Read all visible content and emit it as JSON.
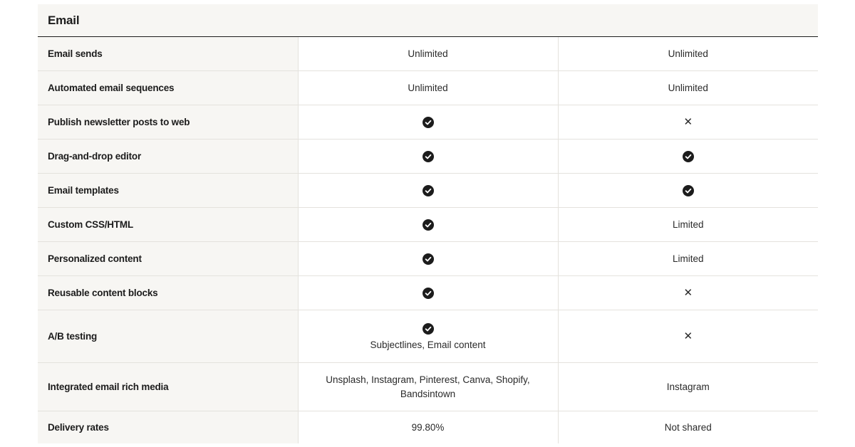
{
  "section": {
    "title": "Email"
  },
  "rows": [
    {
      "feature": "Email sends",
      "col1": {
        "type": "text",
        "text": "Unlimited"
      },
      "col2": {
        "type": "text",
        "text": "Unlimited"
      }
    },
    {
      "feature": "Automated email sequences",
      "col1": {
        "type": "text",
        "text": "Unlimited"
      },
      "col2": {
        "type": "text",
        "text": "Unlimited"
      }
    },
    {
      "feature": "Publish newsletter posts to web",
      "col1": {
        "type": "icon",
        "icon": "check-icon"
      },
      "col2": {
        "type": "icon",
        "icon": "cross-icon"
      }
    },
    {
      "feature": "Drag-and-drop editor",
      "col1": {
        "type": "icon",
        "icon": "check-icon"
      },
      "col2": {
        "type": "icon",
        "icon": "check-icon"
      }
    },
    {
      "feature": "Email templates",
      "col1": {
        "type": "icon",
        "icon": "check-icon"
      },
      "col2": {
        "type": "icon",
        "icon": "check-icon"
      }
    },
    {
      "feature": "Custom CSS/HTML",
      "col1": {
        "type": "icon",
        "icon": "check-icon"
      },
      "col2": {
        "type": "text",
        "text": "Limited"
      }
    },
    {
      "feature": "Personalized content",
      "col1": {
        "type": "icon",
        "icon": "check-icon"
      },
      "col2": {
        "type": "text",
        "text": "Limited"
      }
    },
    {
      "feature": "Reusable content blocks",
      "col1": {
        "type": "icon",
        "icon": "check-icon"
      },
      "col2": {
        "type": "icon",
        "icon": "cross-icon"
      }
    },
    {
      "feature": "A/B testing",
      "col1": {
        "type": "icon-text",
        "icon": "check-icon",
        "text": "Subjectlines, Email content"
      },
      "col2": {
        "type": "icon",
        "icon": "cross-icon"
      }
    },
    {
      "feature": "Integrated email rich media",
      "col1": {
        "type": "text",
        "text": "Unsplash, Instagram, Pinterest, Canva, Shopify, Bandsintown"
      },
      "col2": {
        "type": "text",
        "text": "Instagram"
      }
    },
    {
      "feature": "Delivery rates",
      "col1": {
        "type": "text",
        "text": "99.80%"
      },
      "col2": {
        "type": "text",
        "text": "Not shared"
      }
    }
  ],
  "colors": {
    "header_bg": "#f7f6f3",
    "border": "#e4e2dd",
    "text": "#1c1c1c"
  }
}
